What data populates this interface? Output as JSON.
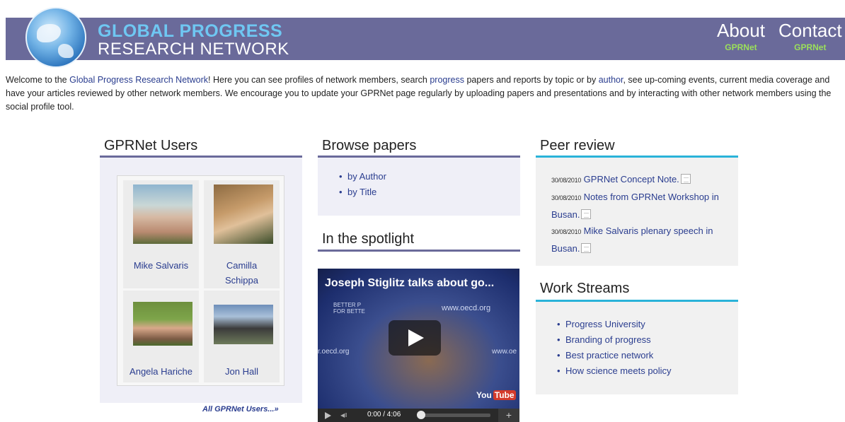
{
  "header": {
    "logo_line1": "GLOBAL PROGRESS",
    "logo_line2": "RESEARCH NETWORK",
    "nav": [
      {
        "label": "About",
        "sub": "GPRNet"
      },
      {
        "label": "Contact",
        "sub": "GPRNet"
      }
    ]
  },
  "intro": {
    "part1": "Welcome to the ",
    "link_gprn": "Global Progress Research Network",
    "part2": "! Here you can see profiles of network members, search ",
    "link_progress": "progress",
    "part3": " papers and reports by topic or by ",
    "link_author": "author",
    "part4": ", see up-coming events, current media coverage and have your articles reviewed by other network members. We encourage you to update your GPRNet page regularly by uploading papers and presentations and by interacting with other network members using the social profile tool."
  },
  "users": {
    "title": "GPRNet Users",
    "list": [
      {
        "name": "Mike Salvaris"
      },
      {
        "name": "Camilla Schippa"
      },
      {
        "name": "Angela Hariche"
      },
      {
        "name": "Jon Hall"
      }
    ],
    "all_link": "All GPRNet Users...»"
  },
  "browse": {
    "title": "Browse papers",
    "items": [
      "by Author",
      "by Title"
    ]
  },
  "spotlight": {
    "title": "In the spotlight",
    "video_title": "Joseph Stiglitz talks about go...",
    "brand_text": "BETTER P\nFOR BETTE",
    "url": "www.oecd.org",
    "url_left": "r.oecd.org",
    "url_right": "www.oe",
    "time": "0:00 / 4:06",
    "yt_you": "You",
    "yt_tube": "Tube",
    "plus": "+"
  },
  "peer": {
    "title": "Peer review",
    "items": [
      {
        "date": "30/08/2010",
        "title": "GPRNet Concept Note."
      },
      {
        "date": "30/08/2010",
        "title": "Notes from GPRNet Workshop in Busan."
      },
      {
        "date": "30/08/2010",
        "title": "Mike Salvaris plenary speech in Busan."
      }
    ]
  },
  "workstreams": {
    "title": "Work Streams",
    "items": [
      "Progress University",
      "Branding of progress",
      "Best practice network",
      "How science meets policy"
    ]
  }
}
